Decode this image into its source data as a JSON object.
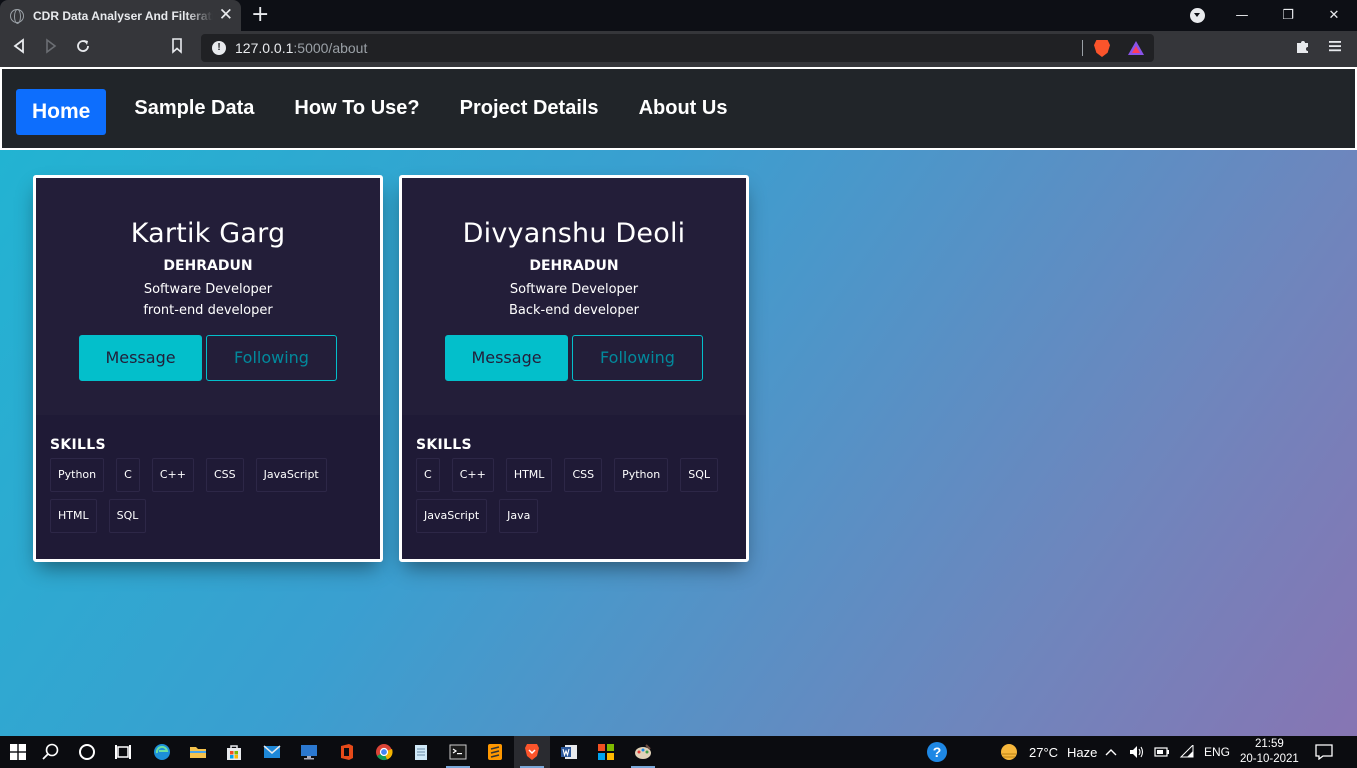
{
  "browser": {
    "tab_title": "CDR Data Analyser And Filteration",
    "tab_close": "✕",
    "new_tab": "+",
    "url_host": "127.0.0.1",
    "url_rest": ":5000/about",
    "window_controls": {
      "minimize": "—",
      "maximize": "❐",
      "close": "✕"
    },
    "icons": [
      "back-icon",
      "forward-icon",
      "reload-icon",
      "bookmark-icon",
      "site-info-icon",
      "brave-shields-icon",
      "brave-rewards-icon",
      "extensions-icon",
      "menu-icon"
    ]
  },
  "navbar": {
    "home": "Home",
    "links": [
      "Sample Data",
      "How To Use?",
      "Project Details",
      "About Us"
    ]
  },
  "cards": [
    {
      "name": "Kartik Garg",
      "city": "DEHRADUN",
      "role1": "Software Developer",
      "role2": "front-end developer",
      "message": "Message",
      "following": "Following",
      "skills_title": "SKILLS",
      "skills": [
        "Python",
        "C",
        "C++",
        "CSS",
        "JavaScript",
        "HTML",
        "SQL"
      ]
    },
    {
      "name": "Divyanshu Deoli",
      "city": "DEHRADUN",
      "role1": "Software Developer",
      "role2": "Back-end developer",
      "message": "Message",
      "following": "Following",
      "skills_title": "SKILLS",
      "skills": [
        "C",
        "C++",
        "HTML",
        "CSS",
        "Python",
        "SQL",
        "JavaScript",
        "Java"
      ]
    }
  ],
  "colors": {
    "accent": "#03bfcb",
    "card_bg": "#231e39",
    "nav_bg": "#212529",
    "home_btn": "#0d6efd"
  },
  "taskbar": {
    "weather_temp": "27°C",
    "weather_text": "Haze",
    "language": "ENG",
    "time": "21:59",
    "date": "20-10-2021"
  }
}
